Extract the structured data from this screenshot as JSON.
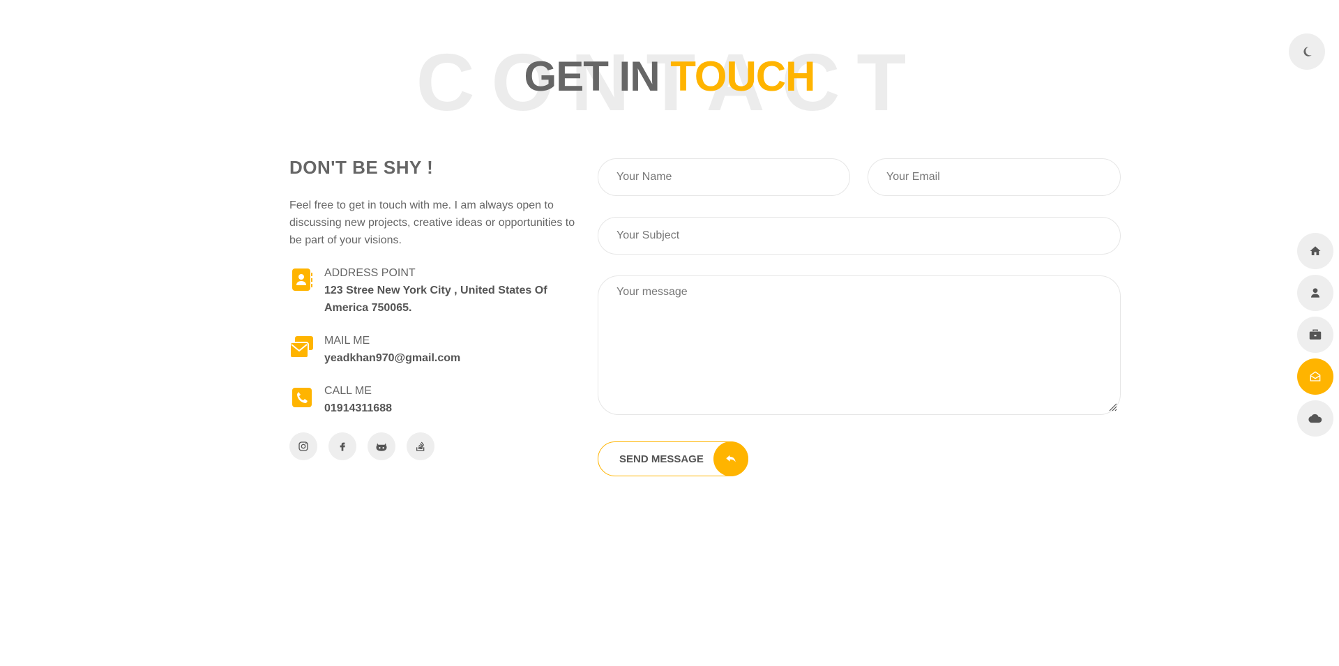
{
  "title": {
    "background_word": "CONTACT",
    "main_part1": "GET IN",
    "main_part2": "TOUCH"
  },
  "colors": {
    "accent": "#ffb400",
    "text": "#666666",
    "muted_bg": "#eeeeee"
  },
  "info": {
    "heading": "DON'T BE SHY !",
    "intro": "Feel free to get in touch with me. I am always open to discussing new projects, creative ideas or opportunities to be part of your visions.",
    "items": [
      {
        "icon": "address-book-icon",
        "label": "ADDRESS POINT",
        "value": "123 Stree New York City , United States Of America 750065."
      },
      {
        "icon": "envelope-icon",
        "label": "MAIL ME",
        "value": "yeadkhan970@gmail.com"
      },
      {
        "icon": "phone-icon",
        "label": "CALL ME",
        "value": "01914311688"
      }
    ],
    "socials": [
      "instagram-icon",
      "facebook-icon",
      "github-icon",
      "stackoverflow-icon"
    ]
  },
  "form": {
    "name_placeholder": "Your Name",
    "email_placeholder": "Your Email",
    "subject_placeholder": "Your Subject",
    "message_placeholder": "Your message",
    "submit_label": "SEND MESSAGE"
  },
  "nav": {
    "items": [
      "home-icon",
      "user-icon",
      "briefcase-icon",
      "mail-open-icon",
      "cloud-icon"
    ],
    "active": "mail-open-icon"
  },
  "theme_toggle": "moon-icon"
}
